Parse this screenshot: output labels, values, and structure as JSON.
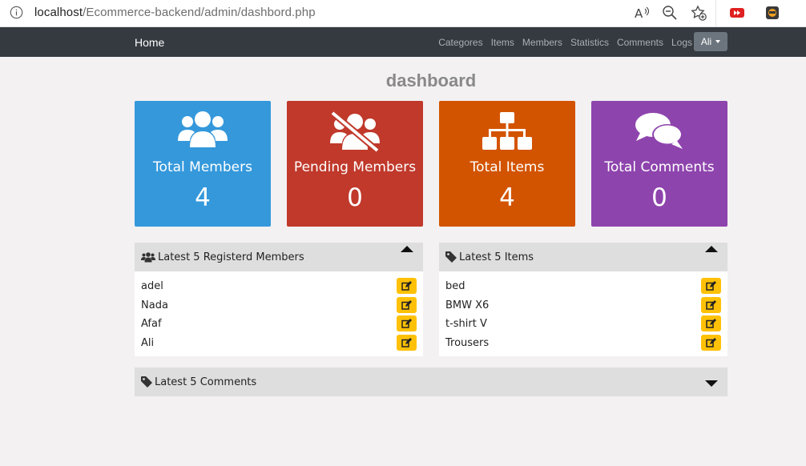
{
  "browser": {
    "url_host": "localhost",
    "url_path": "/Ecommerce-backend/admin/dashbord.php"
  },
  "navbar": {
    "brand": "Home",
    "links": [
      "Categores",
      "Items",
      "Members",
      "Statistics",
      "Comments",
      "Logs"
    ],
    "user": "Ali"
  },
  "page": {
    "title": "dashboard"
  },
  "stats": [
    {
      "label": "Total Members",
      "count": "4",
      "color": "#3498db",
      "icon": "users-icon"
    },
    {
      "label": "Pending Members",
      "count": "0",
      "color": "#c0392b",
      "icon": "users-slash-icon"
    },
    {
      "label": "Total Items",
      "count": "4",
      "color": "#d35400",
      "icon": "sitemap-icon"
    },
    {
      "label": "Total Comments",
      "count": "0",
      "color": "#8e44ad",
      "icon": "comments-icon"
    }
  ],
  "panels": {
    "members": {
      "title": "Latest 5 Registerd Members",
      "rows": [
        "adel",
        "Nada",
        "Afaf",
        "Ali"
      ]
    },
    "items": {
      "title": "Latest 5 Items",
      "rows": [
        "bed",
        "BMW X6",
        "t-shirt V",
        "Trousers"
      ]
    },
    "comments": {
      "title": "Latest 5 Comments"
    }
  },
  "colors": {
    "navbar": "#343a40",
    "edit_button": "#ffc107",
    "panel_header": "#dedede"
  }
}
